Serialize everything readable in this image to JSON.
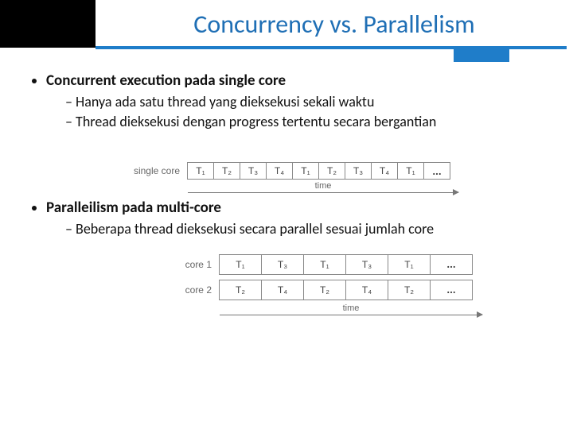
{
  "title": "Concurrency vs. Parallelism",
  "bullets": {
    "b1": "Concurrent execution pada single core",
    "b1_subs": {
      "s1": "Hanya ada satu thread yang dieksekusi sekali waktu",
      "s2": "Thread dieksekusi dengan progress tertentu secara bergantian"
    },
    "b2": "Paralleilism pada multi-core",
    "b2_subs": {
      "s1": "Beberapa thread dieksekusi secara parallel sesuai jumlah core"
    }
  },
  "fig1": {
    "row_label": "single core",
    "time_label": "time",
    "cells": [
      "T₁",
      "T₂",
      "T₃",
      "T₄",
      "T₁",
      "T₂",
      "T₃",
      "T₄",
      "T₁"
    ],
    "dots": "..."
  },
  "fig2": {
    "row1_label": "core 1",
    "row2_label": "core 2",
    "time_label": "time",
    "row1_cells": [
      "T₁",
      "T₃",
      "T₁",
      "T₃",
      "T₁"
    ],
    "row2_cells": [
      "T₂",
      "T₄",
      "T₂",
      "T₄",
      "T₂"
    ],
    "dots": "..."
  },
  "chart_data": [
    {
      "type": "table",
      "title": "single-core concurrent execution timeline",
      "rows": [
        {
          "label": "single core",
          "slots": [
            "T1",
            "T2",
            "T3",
            "T4",
            "T1",
            "T2",
            "T3",
            "T4",
            "T1",
            "..."
          ]
        }
      ],
      "xlabel": "time"
    },
    {
      "type": "table",
      "title": "multi-core parallel execution timeline",
      "rows": [
        {
          "label": "core 1",
          "slots": [
            "T1",
            "T3",
            "T1",
            "T3",
            "T1",
            "..."
          ]
        },
        {
          "label": "core 2",
          "slots": [
            "T2",
            "T4",
            "T2",
            "T4",
            "T2",
            "..."
          ]
        }
      ],
      "xlabel": "time"
    }
  ]
}
